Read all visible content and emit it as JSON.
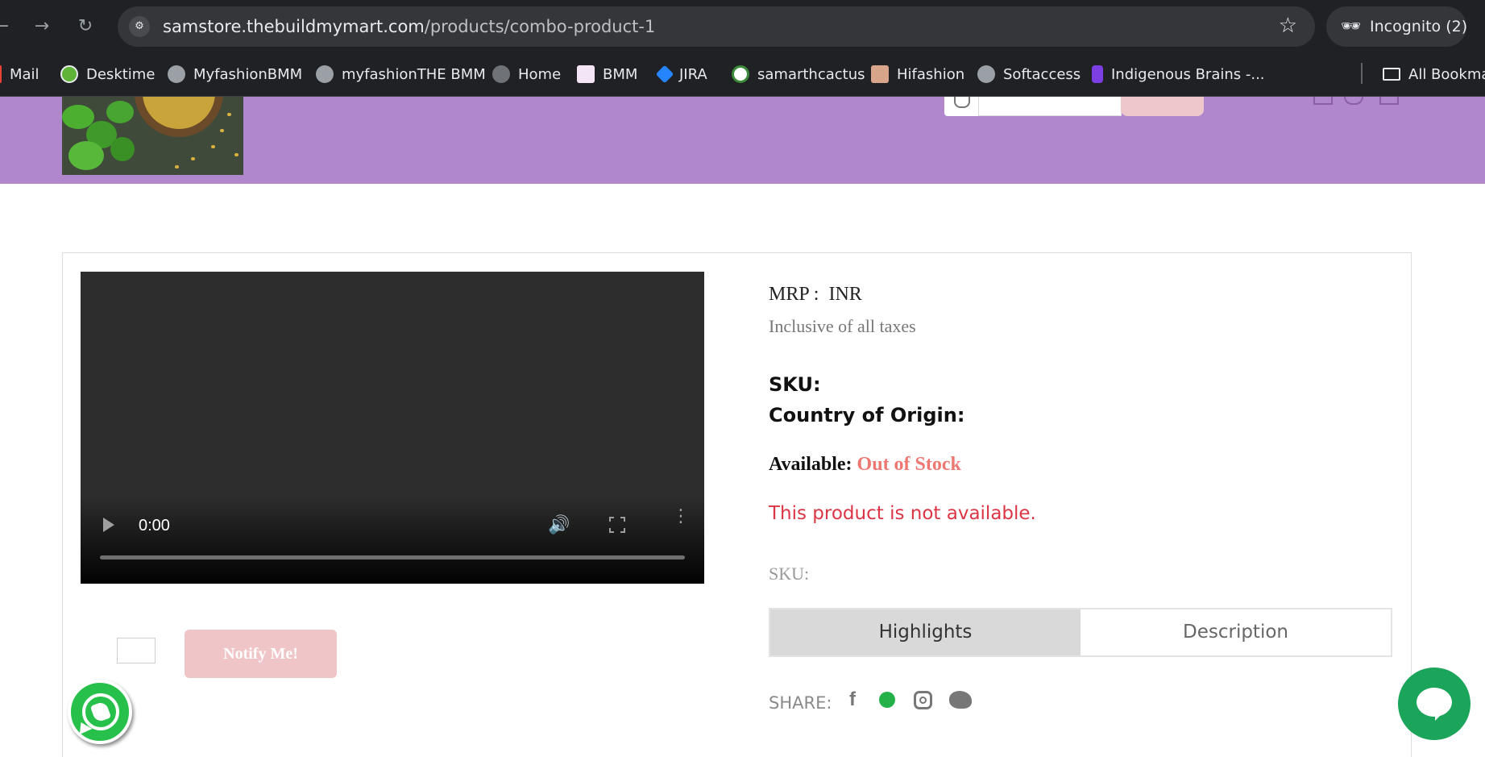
{
  "browser": {
    "url_host": "samstore.thebuildmymart.com",
    "url_path": "/products/combo-product-1",
    "incognito_label": "Incognito (2)",
    "bookmarks": [
      {
        "label": "Mail",
        "icon": "gmail-icon"
      },
      {
        "label": "Desktime",
        "icon": "desktime-icon"
      },
      {
        "label": "MyfashionBMM",
        "icon": "globe-icon"
      },
      {
        "label": "myfashionTHE BMM",
        "icon": "globe-icon"
      },
      {
        "label": "Home",
        "icon": "globe-icon"
      },
      {
        "label": "BMM",
        "icon": "bmm-icon"
      },
      {
        "label": "JIRA",
        "icon": "jira-icon"
      },
      {
        "label": "samarthcactus",
        "icon": "cactus-icon"
      },
      {
        "label": "Hifashion",
        "icon": "avatar-icon"
      },
      {
        "label": "Softaccess",
        "icon": "globe-icon"
      },
      {
        "label": "Indigenous Brains -...",
        "icon": "brain-icon"
      }
    ],
    "all_bookmarks_label": "All Bookma"
  },
  "product": {
    "mrp_label": "MRP :  INR",
    "tax_note": "Inclusive of all taxes",
    "sku_label": "SKU:",
    "origin_label": "Country of Origin:",
    "available_label": "Available:",
    "stock_status": "Out of Stock",
    "not_available_msg": "This product is not available.",
    "sku_secondary": "SKU:",
    "notify_label": "Notify Me!",
    "video_time": "0:00",
    "tabs": [
      {
        "label": "Highlights",
        "active": true
      },
      {
        "label": "Description",
        "active": false
      }
    ],
    "share_label": "SHARE:"
  },
  "colors": {
    "header_bg": "#b086cc",
    "out_of_stock": "#ee7771",
    "not_available": "#dc3545",
    "notify_bg": "#efc5c8",
    "whatsapp": "#27c04a",
    "chat": "#1aa55a"
  }
}
